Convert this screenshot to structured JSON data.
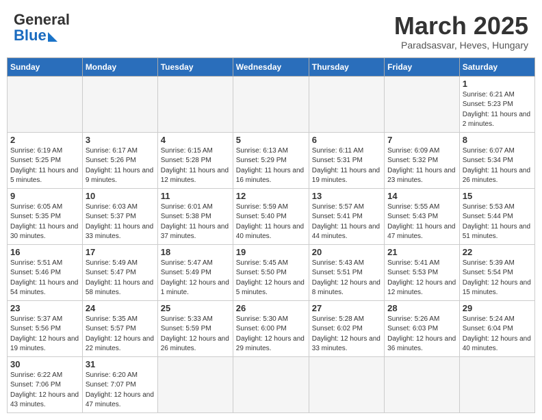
{
  "header": {
    "logo_text_general": "General",
    "logo_text_blue": "Blue",
    "month_title": "March 2025",
    "subtitle": "Paradsasvar, Heves, Hungary"
  },
  "days_of_week": [
    "Sunday",
    "Monday",
    "Tuesday",
    "Wednesday",
    "Thursday",
    "Friday",
    "Saturday"
  ],
  "weeks": [
    [
      {
        "date": "",
        "info": ""
      },
      {
        "date": "",
        "info": ""
      },
      {
        "date": "",
        "info": ""
      },
      {
        "date": "",
        "info": ""
      },
      {
        "date": "",
        "info": ""
      },
      {
        "date": "",
        "info": ""
      },
      {
        "date": "1",
        "info": "Sunrise: 6:21 AM\nSunset: 5:23 PM\nDaylight: 11 hours and 2 minutes."
      }
    ],
    [
      {
        "date": "2",
        "info": "Sunrise: 6:19 AM\nSunset: 5:25 PM\nDaylight: 11 hours and 5 minutes."
      },
      {
        "date": "3",
        "info": "Sunrise: 6:17 AM\nSunset: 5:26 PM\nDaylight: 11 hours and 9 minutes."
      },
      {
        "date": "4",
        "info": "Sunrise: 6:15 AM\nSunset: 5:28 PM\nDaylight: 11 hours and 12 minutes."
      },
      {
        "date": "5",
        "info": "Sunrise: 6:13 AM\nSunset: 5:29 PM\nDaylight: 11 hours and 16 minutes."
      },
      {
        "date": "6",
        "info": "Sunrise: 6:11 AM\nSunset: 5:31 PM\nDaylight: 11 hours and 19 minutes."
      },
      {
        "date": "7",
        "info": "Sunrise: 6:09 AM\nSunset: 5:32 PM\nDaylight: 11 hours and 23 minutes."
      },
      {
        "date": "8",
        "info": "Sunrise: 6:07 AM\nSunset: 5:34 PM\nDaylight: 11 hours and 26 minutes."
      }
    ],
    [
      {
        "date": "9",
        "info": "Sunrise: 6:05 AM\nSunset: 5:35 PM\nDaylight: 11 hours and 30 minutes."
      },
      {
        "date": "10",
        "info": "Sunrise: 6:03 AM\nSunset: 5:37 PM\nDaylight: 11 hours and 33 minutes."
      },
      {
        "date": "11",
        "info": "Sunrise: 6:01 AM\nSunset: 5:38 PM\nDaylight: 11 hours and 37 minutes."
      },
      {
        "date": "12",
        "info": "Sunrise: 5:59 AM\nSunset: 5:40 PM\nDaylight: 11 hours and 40 minutes."
      },
      {
        "date": "13",
        "info": "Sunrise: 5:57 AM\nSunset: 5:41 PM\nDaylight: 11 hours and 44 minutes."
      },
      {
        "date": "14",
        "info": "Sunrise: 5:55 AM\nSunset: 5:43 PM\nDaylight: 11 hours and 47 minutes."
      },
      {
        "date": "15",
        "info": "Sunrise: 5:53 AM\nSunset: 5:44 PM\nDaylight: 11 hours and 51 minutes."
      }
    ],
    [
      {
        "date": "16",
        "info": "Sunrise: 5:51 AM\nSunset: 5:46 PM\nDaylight: 11 hours and 54 minutes."
      },
      {
        "date": "17",
        "info": "Sunrise: 5:49 AM\nSunset: 5:47 PM\nDaylight: 11 hours and 58 minutes."
      },
      {
        "date": "18",
        "info": "Sunrise: 5:47 AM\nSunset: 5:49 PM\nDaylight: 12 hours and 1 minute."
      },
      {
        "date": "19",
        "info": "Sunrise: 5:45 AM\nSunset: 5:50 PM\nDaylight: 12 hours and 5 minutes."
      },
      {
        "date": "20",
        "info": "Sunrise: 5:43 AM\nSunset: 5:51 PM\nDaylight: 12 hours and 8 minutes."
      },
      {
        "date": "21",
        "info": "Sunrise: 5:41 AM\nSunset: 5:53 PM\nDaylight: 12 hours and 12 minutes."
      },
      {
        "date": "22",
        "info": "Sunrise: 5:39 AM\nSunset: 5:54 PM\nDaylight: 12 hours and 15 minutes."
      }
    ],
    [
      {
        "date": "23",
        "info": "Sunrise: 5:37 AM\nSunset: 5:56 PM\nDaylight: 12 hours and 19 minutes."
      },
      {
        "date": "24",
        "info": "Sunrise: 5:35 AM\nSunset: 5:57 PM\nDaylight: 12 hours and 22 minutes."
      },
      {
        "date": "25",
        "info": "Sunrise: 5:33 AM\nSunset: 5:59 PM\nDaylight: 12 hours and 26 minutes."
      },
      {
        "date": "26",
        "info": "Sunrise: 5:30 AM\nSunset: 6:00 PM\nDaylight: 12 hours and 29 minutes."
      },
      {
        "date": "27",
        "info": "Sunrise: 5:28 AM\nSunset: 6:02 PM\nDaylight: 12 hours and 33 minutes."
      },
      {
        "date": "28",
        "info": "Sunrise: 5:26 AM\nSunset: 6:03 PM\nDaylight: 12 hours and 36 minutes."
      },
      {
        "date": "29",
        "info": "Sunrise: 5:24 AM\nSunset: 6:04 PM\nDaylight: 12 hours and 40 minutes."
      }
    ],
    [
      {
        "date": "30",
        "info": "Sunrise: 6:22 AM\nSunset: 7:06 PM\nDaylight: 12 hours and 43 minutes."
      },
      {
        "date": "31",
        "info": "Sunrise: 6:20 AM\nSunset: 7:07 PM\nDaylight: 12 hours and 47 minutes."
      },
      {
        "date": "",
        "info": ""
      },
      {
        "date": "",
        "info": ""
      },
      {
        "date": "",
        "info": ""
      },
      {
        "date": "",
        "info": ""
      },
      {
        "date": "",
        "info": ""
      }
    ]
  ]
}
